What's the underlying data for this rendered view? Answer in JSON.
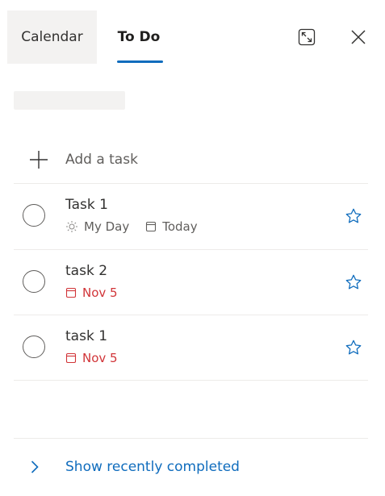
{
  "header": {
    "tabs": [
      {
        "label": "Calendar"
      },
      {
        "label": "To Do",
        "selected": true
      }
    ],
    "accent_color": "#0f6cbd"
  },
  "add_task": {
    "label": "Add a task",
    "icon": "plus-icon"
  },
  "tasks": [
    {
      "title": "Task 1",
      "completed": false,
      "important": false,
      "meta": [
        {
          "icon": "sun-icon",
          "text": "My Day",
          "color": "#605e5c"
        },
        {
          "icon": "calendar-icon",
          "text": "Today",
          "color": "#605e5c"
        }
      ]
    },
    {
      "title": "task 2",
      "completed": false,
      "important": false,
      "meta": [
        {
          "icon": "calendar-icon",
          "text": "Nov 5",
          "color": "#d13438"
        }
      ]
    },
    {
      "title": "task 1",
      "completed": false,
      "important": false,
      "meta": [
        {
          "icon": "calendar-icon",
          "text": "Nov 5",
          "color": "#d13438"
        }
      ]
    }
  ],
  "footer": {
    "show_completed_label": "Show recently completed",
    "icon": "chevron-right-icon"
  },
  "colors": {
    "overdue": "#d13438",
    "link": "#0f6cbd",
    "star": "#0f6cbd"
  }
}
